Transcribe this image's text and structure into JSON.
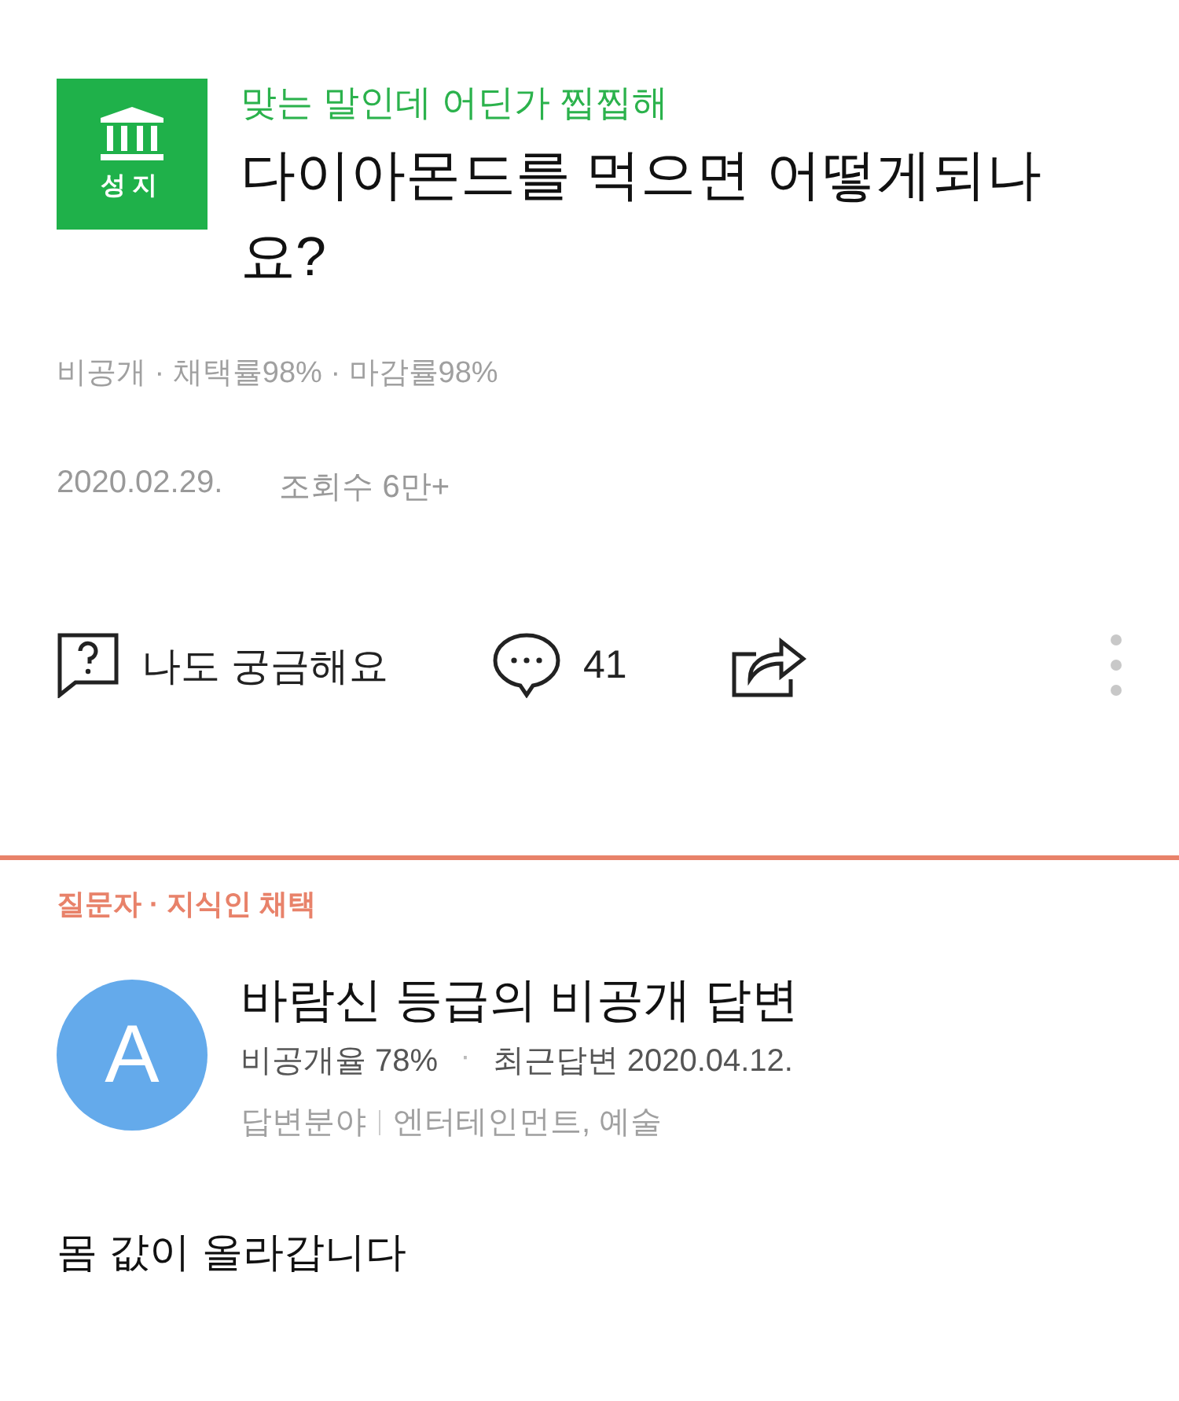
{
  "question": {
    "badge": "성지",
    "tag": "맞는 말인데 어딘가 찝찝해",
    "title": "다이아몬드를 먹으면 어떻게되나요?",
    "meta": "비공개 · 채택률98% · 마감률98%",
    "date": "2020.02.29.",
    "views": "조회수 6만+"
  },
  "actions": {
    "curious": "나도 궁금해요",
    "comments": "41"
  },
  "answer": {
    "label": "질문자 · 지식인 채택",
    "avatar": "A",
    "name": "바람신 등급의 비공개 답변",
    "rate": "비공개율 78%",
    "separator": "·",
    "recent": "최근답변 2020.04.12.",
    "field_label": "답변분야",
    "fields": "엔터테인먼트, 예술",
    "body": "몸 값이 올라갑니다"
  }
}
